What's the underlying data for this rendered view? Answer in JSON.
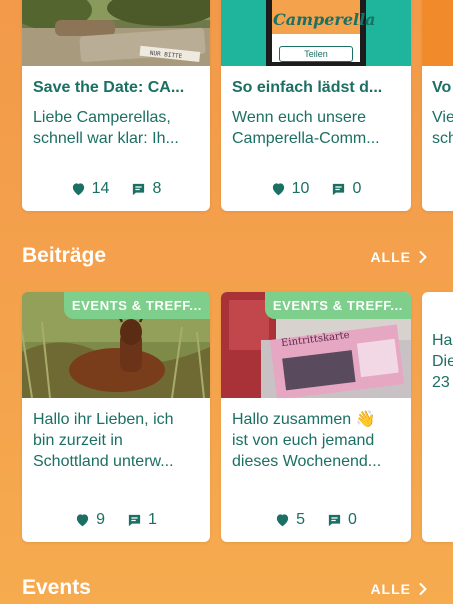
{
  "posts_top": [
    {
      "title": "Save the Date: CA...",
      "body": [
        "Liebe Camperellas,",
        "schnell war klar: Ih..."
      ],
      "likes": "14",
      "comments": "8"
    },
    {
      "title": "So einfach lädst d...",
      "body": [
        "Wenn euch unsere",
        "Camperella-Comm..."
      ],
      "likes": "10",
      "comments": "0",
      "image_logo": "Camperella",
      "image_button": "Teilen"
    },
    {
      "title": "Vo",
      "body": [
        "Vie",
        "sch"
      ]
    }
  ],
  "sections": {
    "beitraege": {
      "title": "Beiträge",
      "all_label": "ALLE"
    },
    "events": {
      "title": "Events",
      "all_label": "ALLE"
    }
  },
  "posts_beitraege": [
    {
      "badge": "EVENTS & TREFF...",
      "body": [
        "Hallo ihr Lieben, ich",
        "bin zurzeit in",
        "Schottland unterw..."
      ],
      "likes": "9",
      "comments": "1"
    },
    {
      "badge": "EVENTS & TREFF...",
      "body": [
        "Hallo zusammen 👋",
        "ist von euch jemand",
        "dieses Wochenend..."
      ],
      "likes": "5",
      "comments": "0",
      "image_text": "Eintrittskarte"
    },
    {
      "body": [
        "Ha",
        "Die",
        "23"
      ]
    }
  ],
  "colors": {
    "accent": "#1b6f63",
    "background": "#f29a4a",
    "badge": "#7ecf8c",
    "teal_banner": "#1fb59c"
  }
}
